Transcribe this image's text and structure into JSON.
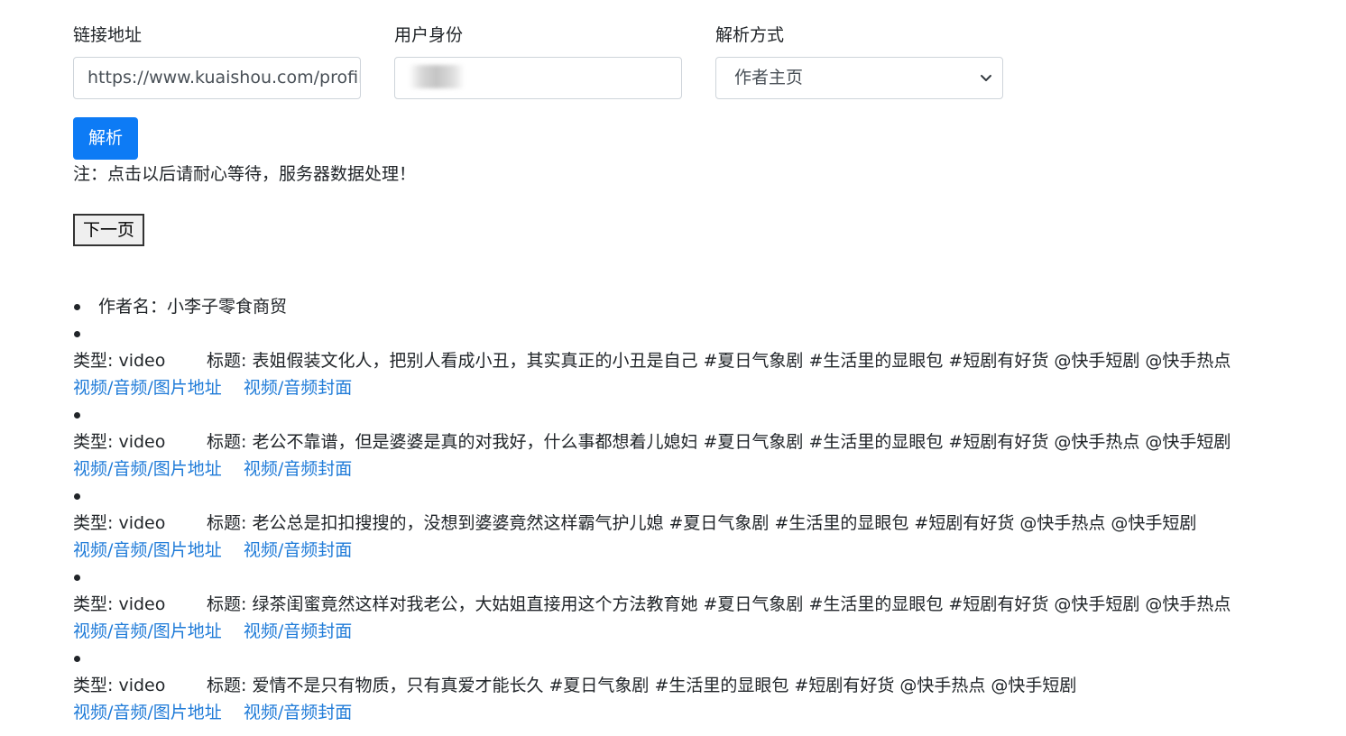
{
  "form": {
    "url_label": "链接地址",
    "url_value": "https://www.kuaishou.com/profil",
    "identity_label": "用户身份",
    "mode_label": "解析方式",
    "mode_value": "作者主页",
    "parse_button": "解析",
    "note": "注：点击以后请耐心等待，服务器数据处理！",
    "next_button": "下一页"
  },
  "author": "作者名：小李子零食商贸",
  "type_prefix": "类型: ",
  "title_prefix": "标题: ",
  "link_media": "视频/音频/图片地址",
  "link_cover": "视频/音频封面",
  "items": [
    {
      "type": "video",
      "title": "表姐假装文化人，把别人看成小丑，其实真正的小丑是自己 #夏日气象剧  #生活里的显眼包  #短剧有好货  @快手短剧  @快手热点"
    },
    {
      "type": "video",
      "title": "老公不靠谱，但是婆婆是真的对我好，什么事都想着儿媳妇 #夏日气象剧  #生活里的显眼包  #短剧有好货  @快手热点  @快手短剧"
    },
    {
      "type": "video",
      "title": "老公总是扣扣搜搜的，没想到婆婆竟然这样霸气护儿媳 #夏日气象剧 #生活里的显眼包 #短剧有好货 @快手热点 @快手短剧"
    },
    {
      "type": "video",
      "title": "绿茶闺蜜竟然这样对我老公，大姑姐直接用这个方法教育她 #夏日气象剧  #生活里的显眼包  #短剧有好货  @快手短剧  @快手热点"
    },
    {
      "type": "video",
      "title": "爱情不是只有物质，只有真爱才能长久 #夏日气象剧  #生活里的显眼包  #短剧有好货  @快手热点  @快手短剧"
    }
  ]
}
